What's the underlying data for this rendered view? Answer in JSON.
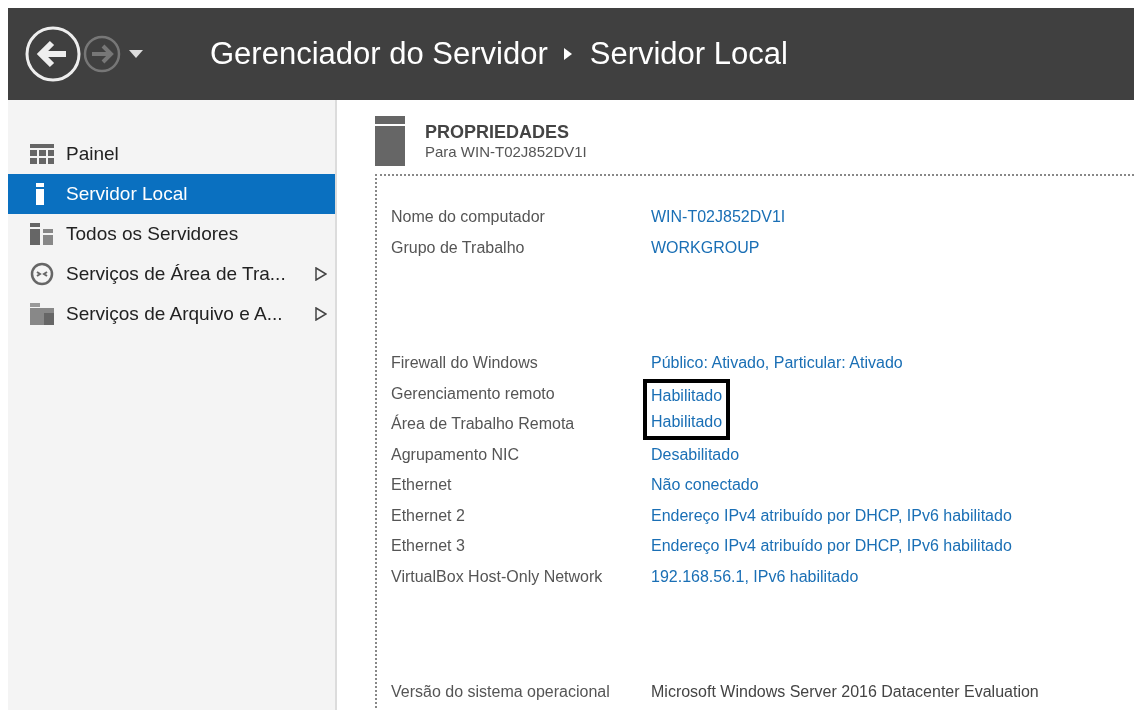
{
  "header": {
    "title": "Gerenciador do Servidor",
    "breadcrumb": "Servidor Local"
  },
  "sidebar": {
    "items": [
      {
        "label": "Painel",
        "kind": "dashboard",
        "selected": false,
        "expandable": false
      },
      {
        "label": "Servidor Local",
        "kind": "server",
        "selected": true,
        "expandable": false
      },
      {
        "label": "Todos os Servidores",
        "kind": "servers",
        "selected": false,
        "expandable": false
      },
      {
        "label": "Serviços de Área de Tra...",
        "kind": "remote",
        "selected": false,
        "expandable": true
      },
      {
        "label": "Serviços de Arquivo e A...",
        "kind": "files",
        "selected": false,
        "expandable": true
      }
    ]
  },
  "properties": {
    "title": "PROPRIEDADES",
    "subtitle": "Para WIN-T02J852DV1I",
    "groups": [
      {
        "rows": [
          {
            "label": "Nome do computador",
            "value": "WIN-T02J852DV1I",
            "kind": "link",
            "highlighted": false
          },
          {
            "label": "Grupo de Trabalho",
            "value": "WORKGROUP",
            "kind": "link",
            "highlighted": false
          }
        ]
      },
      {
        "rows": [
          {
            "label": "Firewall do Windows",
            "value": "Público: Ativado, Particular: Ativado",
            "kind": "link",
            "highlighted": false
          },
          {
            "label": "Gerenciamento remoto",
            "value": "Habilitado",
            "kind": "link",
            "highlighted": true
          },
          {
            "label": "Área de Trabalho Remota",
            "value": "Habilitado",
            "kind": "link",
            "highlighted": true
          },
          {
            "label": "Agrupamento NIC",
            "value": "Desabilitado",
            "kind": "link",
            "highlighted": false
          },
          {
            "label": "Ethernet",
            "value": "Não conectado",
            "kind": "link",
            "highlighted": false
          },
          {
            "label": "Ethernet 2",
            "value": "Endereço IPv4 atribuído por DHCP, IPv6 habilitado",
            "kind": "link",
            "highlighted": false
          },
          {
            "label": "Ethernet 3",
            "value": "Endereço IPv4 atribuído por DHCP, IPv6 habilitado",
            "kind": "link",
            "highlighted": false
          },
          {
            "label": "VirtualBox Host-Only Network",
            "value": "192.168.56.1, IPv6 habilitado",
            "kind": "link",
            "highlighted": false
          }
        ]
      },
      {
        "rows": [
          {
            "label": "Versão do sistema operacional",
            "value": "Microsoft Windows Server 2016 Datacenter Evaluation",
            "kind": "text",
            "highlighted": false
          }
        ]
      }
    ]
  }
}
